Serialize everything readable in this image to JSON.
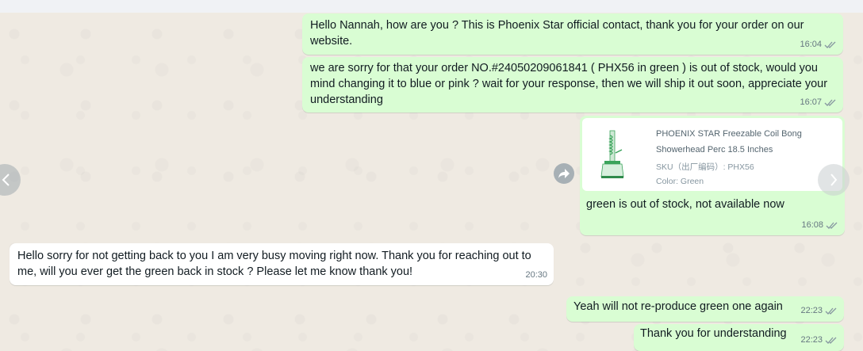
{
  "messages": [
    {
      "direction": "out",
      "text": "Hello Nannah, how are you ? This is Phoenix Star official contact, thank you for your order on our website.",
      "time": "16:04",
      "status": "read"
    },
    {
      "direction": "out",
      "text": "we are sorry for that your order NO.#24050209061841 ( PHX56 in green ) is out of stock, would you mind changing it to blue or pink ? wait for your response, then we will ship it out soon, appreciate your understanding",
      "time": "16:07",
      "status": "read"
    },
    {
      "direction": "out",
      "product": {
        "title": "PHOENIX STAR Freezable Coil Bong Showerhead Perc 18.5 Inches",
        "sku": "SKU（出厂编码）: PHX56",
        "color": "Color: Green"
      },
      "text": "green is out of stock, not available now",
      "time": "16:08",
      "status": "read"
    },
    {
      "direction": "in",
      "text": "Hello sorry for not getting back to you I am very busy moving right now. Thank you for reaching out to me, will you ever get the green back in stock ? Please let me know thank you!",
      "time": "20:30"
    },
    {
      "direction": "out",
      "text": "Yeah will not re-produce green one again",
      "time": "22:23",
      "status": "read"
    },
    {
      "direction": "out",
      "text": "Thank you for understanding",
      "time": "22:23",
      "status": "read"
    }
  ],
  "icons": {
    "nav_left": "chevron-left-icon",
    "nav_right": "chevron-right-icon",
    "forward": "forward-icon",
    "read_receipt": "double-check-icon"
  },
  "colors": {
    "outgoing_bubble": "#d9fdd3",
    "incoming_bubble": "#ffffff",
    "chat_background": "#efeae2",
    "read_ticks": "#8696a0",
    "product_green": "#3aa35b"
  }
}
